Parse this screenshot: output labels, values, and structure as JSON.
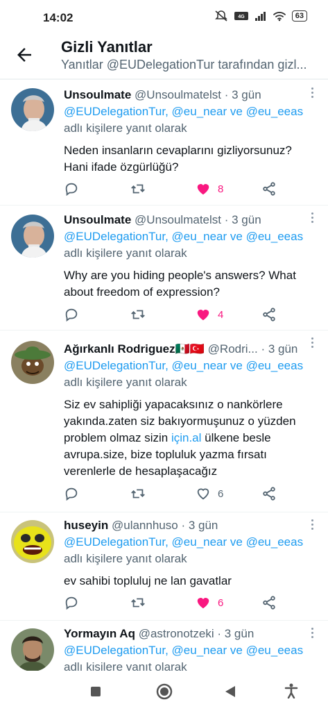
{
  "status_bar": {
    "time": "14:02",
    "battery": "63"
  },
  "header": {
    "title": "Gizli Yanıtlar",
    "subtitle": "Yanıtlar @EUDelegationTur tarafından gizl..."
  },
  "reply_to": {
    "mentions": "@EUDelegationTur, @eu_near ve @eu_eeas",
    "suffix": "adlı kişilere yanıt olarak"
  },
  "tweets": [
    {
      "name": "Unsoulmate",
      "handle": "@Unsoulmatelst",
      "time": "· 3 gün",
      "text_lines": [
        "Neden insanların cevaplarını gizliyorsunuz?",
        "Hani ifade özgürlüğü?"
      ],
      "likes": "8",
      "liked": true
    },
    {
      "name": "Unsoulmate",
      "handle": "@Unsoulmatelst",
      "time": "· 3 gün",
      "text_lines": [
        "Why are you hiding people's answers? What",
        "about freedom of expression?"
      ],
      "likes": "4",
      "liked": true
    },
    {
      "name": "Ağırkanlı Rodriguez",
      "flags": "🇲🇽🇹🇷",
      "handle": "@Rodri...",
      "time": "· 3 gün",
      "text_lines": [
        "Siz ev sahipliği yapacaksınız o nankörlere",
        "yakında.zaten siz bakıyormuşunuz o yüzden"
      ],
      "text_line3_pre": "problem olmaz sizin ",
      "text_line3_link": "için.al",
      "text_line3_post": " ülkene besle",
      "text_lines_after": [
        "avrupa.size, bize topluluk yazma fırsatı",
        "verenlerle de hesaplaşacağız"
      ],
      "likes": "6",
      "liked": false
    },
    {
      "name": "huseyin",
      "handle": "@ulannhuso",
      "time": "· 3 gün",
      "text_lines": [
        "ev sahibi topluluj ne lan gavatlar"
      ],
      "likes": "6",
      "liked": true
    },
    {
      "name": "Yormayın Aq",
      "handle": "@astronotzeki",
      "time": "· 3 gün"
    }
  ],
  "colors": {
    "like": "#f91880",
    "link": "#1d9bf0",
    "secondary": "#536471"
  },
  "icons": [
    "back-arrow-icon",
    "reply-icon",
    "retweet-icon",
    "heart-icon",
    "share-icon",
    "more-icon"
  ]
}
